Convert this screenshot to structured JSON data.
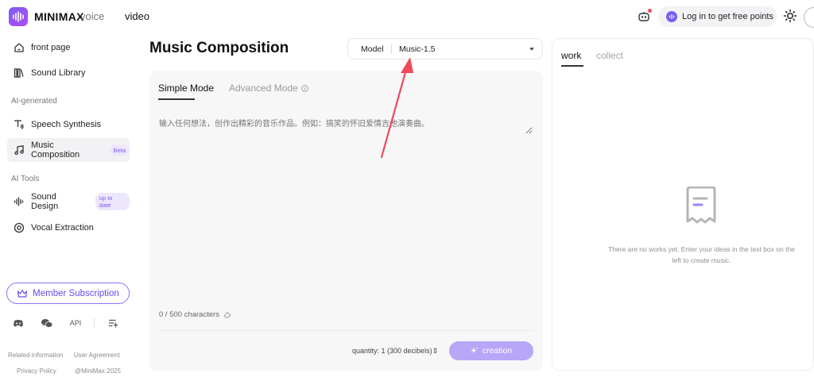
{
  "header": {
    "brand": "MINIMAX",
    "nav": {
      "voice": "voice",
      "video": "video"
    },
    "login_label": "Log in to get free points"
  },
  "sidebar": {
    "items": [
      {
        "label": "front page"
      },
      {
        "label": "Sound Library"
      },
      {
        "label": "Speech Synthesis"
      },
      {
        "label": "Music Composition",
        "badge": "Beta"
      },
      {
        "label": "Sound Design",
        "badge": "up to date"
      },
      {
        "label": "Vocal Extraction"
      }
    ],
    "sections": {
      "ai_generated": "AI-generated",
      "ai_tools": "AI Tools"
    },
    "member_label": "Member Subscription",
    "footer": {
      "api": "API"
    },
    "legal": {
      "related": "Related information",
      "agreement": "User Agreement",
      "privacy": "Privacy Policy",
      "copyright": "@MiniMax 2025"
    }
  },
  "main": {
    "title": "Music Composition",
    "model": {
      "label": "Model",
      "value": "Music-1.5"
    },
    "tabs": {
      "simple": "Simple Mode",
      "advanced": "Advanced Mode"
    },
    "prompt_placeholder": "输入任何想法，创作出精彩的音乐作品。例如：搞笑的怀旧爱情吉他演奏曲。",
    "char_count": "0 / 500 characters",
    "quantity": "quantity: 1 (300 decibels)",
    "create_label": "creation"
  },
  "works": {
    "tabs": {
      "work": "work",
      "collect": "collect"
    },
    "empty_text": "There are no works yet. Enter your ideas in the text box on the left to create music."
  },
  "colors": {
    "accent": "#7c5cf3",
    "annotation_arrow": "#ef4a5a"
  }
}
